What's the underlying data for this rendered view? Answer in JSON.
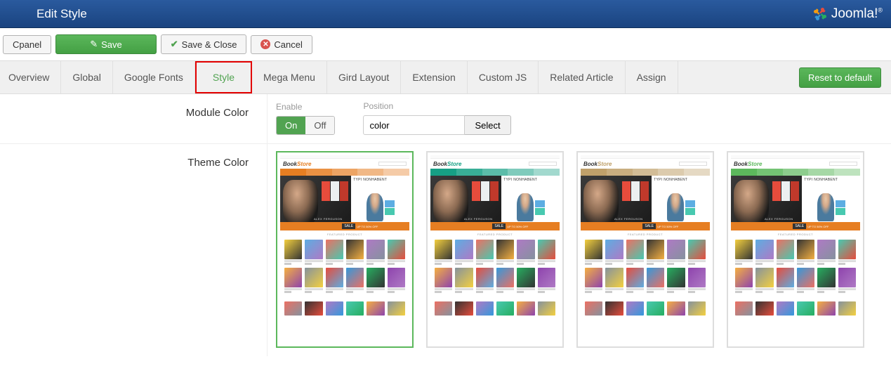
{
  "header": {
    "title": "Edit Style",
    "brand": "Joomla!"
  },
  "toolbar": {
    "cpanel": "Cpanel",
    "save": "Save",
    "save_close": "Save & Close",
    "cancel": "Cancel"
  },
  "tabs": {
    "items": [
      {
        "label": "Overview"
      },
      {
        "label": "Global"
      },
      {
        "label": "Google Fonts"
      },
      {
        "label": "Style"
      },
      {
        "label": "Mega Menu"
      },
      {
        "label": "Gird Layout"
      },
      {
        "label": "Extension"
      },
      {
        "label": "Custom JS"
      },
      {
        "label": "Related Article"
      },
      {
        "label": "Assign"
      }
    ],
    "active": "Style",
    "reset": "Reset to default"
  },
  "module_color": {
    "label": "Module Color",
    "enable_label": "Enable",
    "on": "On",
    "off": "Off",
    "position_label": "Position",
    "position_value": "color",
    "select": "Select"
  },
  "theme_color": {
    "label": "Theme Color",
    "preview": {
      "logo1": "Book",
      "logo2": "Store",
      "typo": "TYPI NONHABENT",
      "ferguson": "ALEX FERGUSON",
      "sale_tag": "SALE",
      "sale_text": "UP TO 50% OFF"
    },
    "themes": [
      {
        "accent": "#e67e22",
        "selected": true
      },
      {
        "accent": "#16a085",
        "selected": false
      },
      {
        "accent": "#bfa06a",
        "selected": false
      },
      {
        "accent": "#5cb85c",
        "selected": false
      }
    ]
  },
  "book_colors": [
    "#f4d03f",
    "#5dade2",
    "#ec7063",
    "#333333",
    "#af7ac5",
    "#48c9b0",
    "#f5b041",
    "#85929e",
    "#e74c3c",
    "#3498db",
    "#27ae60",
    "#8e44ad"
  ]
}
